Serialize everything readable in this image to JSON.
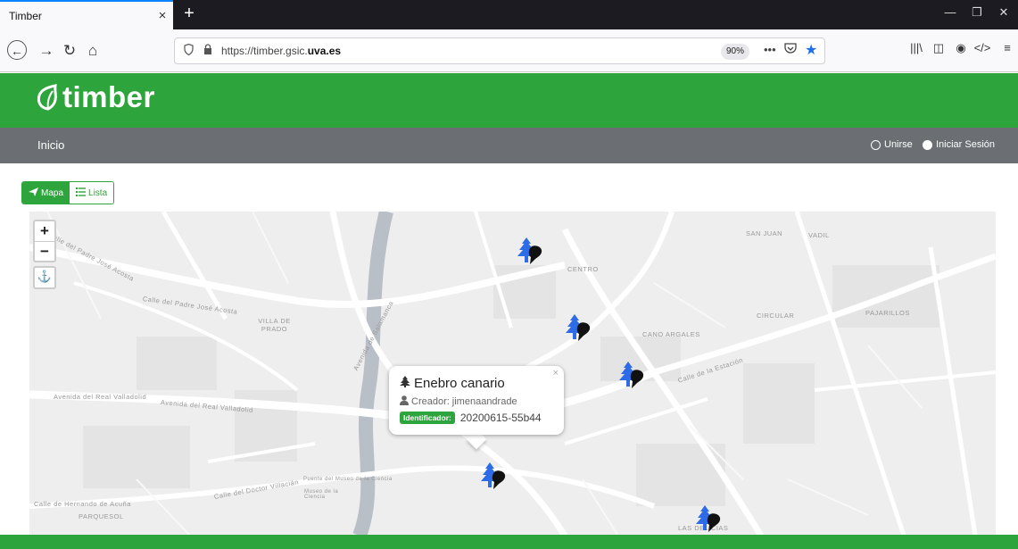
{
  "browser": {
    "tab_title": "Timber",
    "url_prefix": "https://timber.gsic.",
    "url_domain": "uva.es",
    "zoom": "90%"
  },
  "app": {
    "logo_text": "timber",
    "nav": {
      "home": "Inicio",
      "join": "Unirse",
      "login": "Iniciar Sesión"
    },
    "view_toggle": {
      "map": "Mapa",
      "list": "Lista",
      "active": "map"
    }
  },
  "map": {
    "street_labels": [
      "Calle del Padre José Acosta",
      "Calle del Padre José Acosta",
      "VILLA DE PRADO",
      "CENTRO",
      "CANO ARGALES",
      "CIRCULAR",
      "PAJARILLOS",
      "SAN JUAN",
      "VADIL",
      "Avenida del Real Valladolid",
      "Avenida del Real Valladolid",
      "PARQUESOL",
      "Calle de Hernando de Acuña",
      "Avenida de Salamanca",
      "Calle de la Estación",
      "LAS DELICIAS",
      "Museo de la Ciencia",
      "Puente del Museo de la Ciencia",
      "Calle del Doctor Villacián"
    ],
    "popup": {
      "title": "Enebro canario",
      "creator_label": "Creador:",
      "creator": "jimenaandrade",
      "id_label": "Identificador:",
      "id_value": "20200615-55b44"
    },
    "marker_color": "#2e6be6"
  },
  "colors": {
    "brand_green": "#2ea43d",
    "menu_gray": "#6b6f73"
  }
}
